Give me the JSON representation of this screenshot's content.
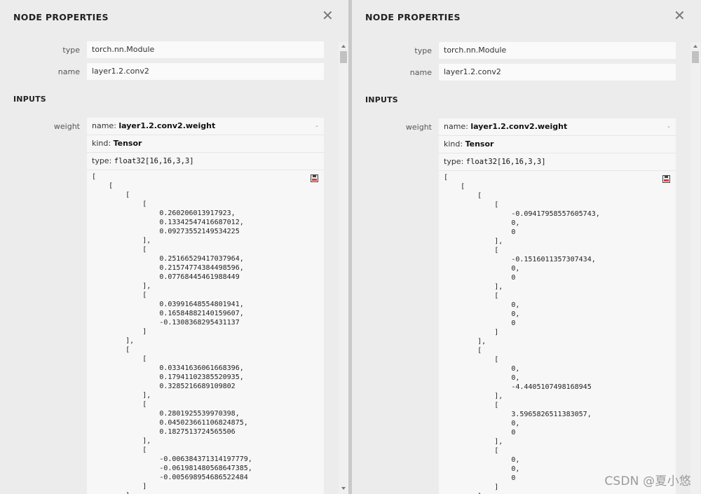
{
  "left": {
    "title": "NODE PROPERTIES",
    "close_glyph": "✕",
    "type_label": "type",
    "type_value": "torch.nn.Module",
    "name_label": "name",
    "name_value": "layer1.2.conv2",
    "inputs_header": "INPUTS",
    "weight_label": "weight",
    "weight": {
      "name_prefix": "name: ",
      "name_value": "layer1.2.conv2.weight",
      "minus": "-",
      "kind_prefix": "kind: ",
      "kind_value": "Tensor",
      "type_prefix": "type: ",
      "type_value": "float32[16,16,3,3]"
    },
    "tensor_lines": [
      "[",
      "    [",
      "        [",
      "            [",
      "                0.260206013917923,",
      "                0.13342547416687012,",
      "                0.09273552149534225",
      "            ],",
      "            [",
      "                0.25166529417037964,",
      "                0.21574774384498596,",
      "                0.07768445461988449",
      "            ],",
      "            [",
      "                0.03991648554801941,",
      "                0.16584882140159607,",
      "                -0.1308368295431137",
      "            ]",
      "        ],",
      "        [",
      "            [",
      "                0.03341636061668396,",
      "                0.17941102385520935,",
      "                0.3285216689109802",
      "            ],",
      "            [",
      "                0.2801925539970398,",
      "                0.045023661106824875,",
      "                0.1827513724565506",
      "            ],",
      "            [",
      "                -0.006384371314197779,",
      "                -0.061981480568647385,",
      "                -0.005698954686522484",
      "            ]",
      "        ]"
    ]
  },
  "right": {
    "title": "NODE PROPERTIES",
    "close_glyph": "✕",
    "type_label": "type",
    "type_value": "torch.nn.Module",
    "name_label": "name",
    "name_value": "layer1.2.conv2",
    "inputs_header": "INPUTS",
    "weight_label": "weight",
    "weight": {
      "name_prefix": "name: ",
      "name_value": "layer1.2.conv2.weight",
      "minus": "-",
      "kind_prefix": "kind: ",
      "kind_value": "Tensor",
      "type_prefix": "type: ",
      "type_value": "float32[16,16,3,3]"
    },
    "tensor_lines": [
      "[",
      "    [",
      "        [",
      "            [",
      "                -0.09417958557605743,",
      "                0,",
      "                0",
      "            ],",
      "            [",
      "                -0.1516011357307434,",
      "                0,",
      "                0",
      "            ],",
      "            [",
      "                0,",
      "                0,",
      "                0",
      "            ]",
      "        ],",
      "        [",
      "            [",
      "                0,",
      "                0,",
      "                -4.4405107498168945",
      "            ],",
      "            [",
      "                3.5965826511383057,",
      "                0,",
      "                0",
      "            ],",
      "            [",
      "                0,",
      "                0,",
      "                0",
      "            ]",
      "        ]"
    ]
  },
  "watermark": "CSDN @夏小悠",
  "colors": {
    "panel_bg": "#ececec",
    "field_bg": "#fafafa",
    "divider": "#c9c9c9"
  },
  "icons": {
    "close": "close-icon",
    "save": "save-icon"
  }
}
